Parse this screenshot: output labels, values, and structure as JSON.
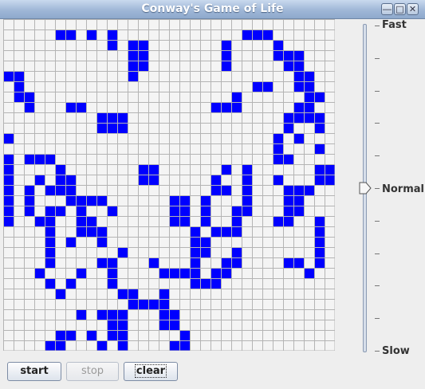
{
  "window": {
    "title": "Conway's Game of Life"
  },
  "title_buttons": [
    "minimize-icon",
    "maximize-icon",
    "close-icon"
  ],
  "grid": {
    "cols": 32,
    "rows": 32,
    "alive_color": "#0000ff",
    "dead_color": "#f4f4f4",
    "line_color": "#b4b4b4",
    "alive": [
      [
        1,
        5
      ],
      [
        1,
        6
      ],
      [
        1,
        8
      ],
      [
        1,
        10
      ],
      [
        1,
        23
      ],
      [
        1,
        24
      ],
      [
        1,
        25
      ],
      [
        2,
        10
      ],
      [
        2,
        12
      ],
      [
        2,
        13
      ],
      [
        2,
        21
      ],
      [
        2,
        26
      ],
      [
        3,
        12
      ],
      [
        3,
        13
      ],
      [
        3,
        21
      ],
      [
        3,
        26
      ],
      [
        3,
        27
      ],
      [
        3,
        28
      ],
      [
        4,
        12
      ],
      [
        4,
        13
      ],
      [
        4,
        21
      ],
      [
        4,
        27
      ],
      [
        4,
        28
      ],
      [
        5,
        0
      ],
      [
        5,
        1
      ],
      [
        5,
        12
      ],
      [
        5,
        28
      ],
      [
        5,
        29
      ],
      [
        6,
        1
      ],
      [
        6,
        24
      ],
      [
        6,
        25
      ],
      [
        6,
        28
      ],
      [
        6,
        29
      ],
      [
        7,
        1
      ],
      [
        7,
        2
      ],
      [
        7,
        22
      ],
      [
        7,
        29
      ],
      [
        7,
        30
      ],
      [
        8,
        2
      ],
      [
        8,
        6
      ],
      [
        8,
        7
      ],
      [
        8,
        20
      ],
      [
        8,
        21
      ],
      [
        8,
        22
      ],
      [
        8,
        28
      ],
      [
        8,
        29
      ],
      [
        9,
        9
      ],
      [
        9,
        10
      ],
      [
        9,
        11
      ],
      [
        9,
        27
      ],
      [
        9,
        28
      ],
      [
        9,
        29
      ],
      [
        9,
        30
      ],
      [
        10,
        9
      ],
      [
        10,
        10
      ],
      [
        10,
        11
      ],
      [
        10,
        27
      ],
      [
        10,
        30
      ],
      [
        11,
        0
      ],
      [
        11,
        26
      ],
      [
        11,
        28
      ],
      [
        12,
        26
      ],
      [
        12,
        30
      ],
      [
        13,
        0
      ],
      [
        13,
        2
      ],
      [
        13,
        3
      ],
      [
        13,
        4
      ],
      [
        13,
        26
      ],
      [
        13,
        27
      ],
      [
        14,
        0
      ],
      [
        14,
        5
      ],
      [
        14,
        13
      ],
      [
        14,
        14
      ],
      [
        14,
        21
      ],
      [
        14,
        23
      ],
      [
        14,
        30
      ],
      [
        14,
        31
      ],
      [
        15,
        0
      ],
      [
        15,
        3
      ],
      [
        15,
        5
      ],
      [
        15,
        6
      ],
      [
        15,
        13
      ],
      [
        15,
        14
      ],
      [
        15,
        20
      ],
      [
        15,
        23
      ],
      [
        15,
        26
      ],
      [
        15,
        30
      ],
      [
        15,
        31
      ],
      [
        16,
        0
      ],
      [
        16,
        2
      ],
      [
        16,
        4
      ],
      [
        16,
        5
      ],
      [
        16,
        6
      ],
      [
        16,
        20
      ],
      [
        16,
        21
      ],
      [
        16,
        23
      ],
      [
        16,
        27
      ],
      [
        16,
        28
      ],
      [
        16,
        29
      ],
      [
        17,
        0
      ],
      [
        17,
        2
      ],
      [
        17,
        6
      ],
      [
        17,
        7
      ],
      [
        17,
        8
      ],
      [
        17,
        9
      ],
      [
        17,
        16
      ],
      [
        17,
        17
      ],
      [
        17,
        19
      ],
      [
        17,
        23
      ],
      [
        17,
        27
      ],
      [
        17,
        28
      ],
      [
        18,
        0
      ],
      [
        18,
        2
      ],
      [
        18,
        4
      ],
      [
        18,
        5
      ],
      [
        18,
        7
      ],
      [
        18,
        10
      ],
      [
        18,
        16
      ],
      [
        18,
        17
      ],
      [
        18,
        19
      ],
      [
        18,
        22
      ],
      [
        18,
        23
      ],
      [
        18,
        27
      ],
      [
        18,
        28
      ],
      [
        19,
        0
      ],
      [
        19,
        3
      ],
      [
        19,
        4
      ],
      [
        19,
        7
      ],
      [
        19,
        8
      ],
      [
        19,
        16
      ],
      [
        19,
        17
      ],
      [
        19,
        19
      ],
      [
        19,
        22
      ],
      [
        19,
        26
      ],
      [
        19,
        27
      ],
      [
        19,
        30
      ],
      [
        20,
        4
      ],
      [
        20,
        7
      ],
      [
        20,
        8
      ],
      [
        20,
        9
      ],
      [
        20,
        18
      ],
      [
        20,
        20
      ],
      [
        20,
        21
      ],
      [
        20,
        22
      ],
      [
        20,
        30
      ],
      [
        21,
        4
      ],
      [
        21,
        6
      ],
      [
        21,
        9
      ],
      [
        21,
        18
      ],
      [
        21,
        19
      ],
      [
        21,
        30
      ],
      [
        22,
        4
      ],
      [
        22,
        11
      ],
      [
        22,
        18
      ],
      [
        22,
        19
      ],
      [
        22,
        22
      ],
      [
        22,
        30
      ],
      [
        23,
        4
      ],
      [
        23,
        9
      ],
      [
        23,
        10
      ],
      [
        23,
        14
      ],
      [
        23,
        18
      ],
      [
        23,
        21
      ],
      [
        23,
        22
      ],
      [
        23,
        27
      ],
      [
        23,
        28
      ],
      [
        23,
        30
      ],
      [
        24,
        3
      ],
      [
        24,
        7
      ],
      [
        24,
        10
      ],
      [
        24,
        15
      ],
      [
        24,
        16
      ],
      [
        24,
        17
      ],
      [
        24,
        18
      ],
      [
        24,
        20
      ],
      [
        24,
        21
      ],
      [
        24,
        29
      ],
      [
        25,
        4
      ],
      [
        25,
        6
      ],
      [
        25,
        10
      ],
      [
        25,
        18
      ],
      [
        25,
        19
      ],
      [
        25,
        20
      ],
      [
        26,
        5
      ],
      [
        26,
        11
      ],
      [
        26,
        12
      ],
      [
        26,
        15
      ],
      [
        27,
        12
      ],
      [
        27,
        13
      ],
      [
        27,
        14
      ],
      [
        27,
        15
      ],
      [
        28,
        7
      ],
      [
        28,
        9
      ],
      [
        28,
        10
      ],
      [
        28,
        11
      ],
      [
        28,
        15
      ],
      [
        28,
        16
      ],
      [
        29,
        10
      ],
      [
        29,
        11
      ],
      [
        29,
        15
      ],
      [
        29,
        16
      ],
      [
        30,
        5
      ],
      [
        30,
        6
      ],
      [
        30,
        8
      ],
      [
        30,
        10
      ],
      [
        30,
        11
      ],
      [
        30,
        17
      ],
      [
        31,
        4
      ],
      [
        31,
        5
      ],
      [
        31,
        9
      ],
      [
        31,
        11
      ],
      [
        31,
        16
      ],
      [
        31,
        17
      ]
    ]
  },
  "speed_slider": {
    "labels": {
      "top": "Fast",
      "middle": "Normal",
      "bottom": "Slow"
    },
    "value_label": "Normal"
  },
  "buttons": {
    "start": "start",
    "stop": "stop",
    "clear": "clear"
  }
}
